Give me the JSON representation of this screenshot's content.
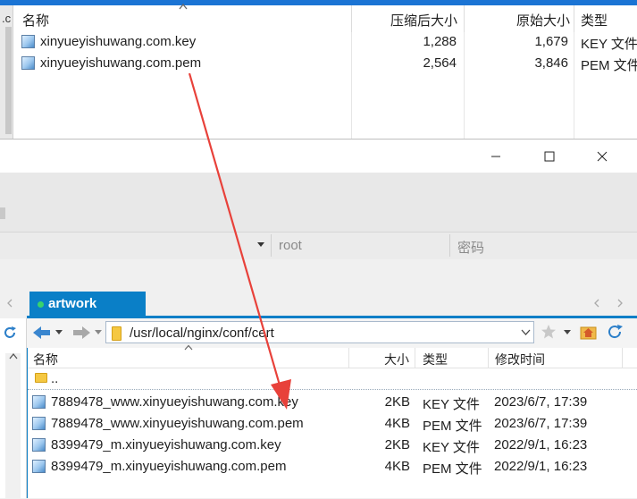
{
  "archive": {
    "left_edge_label": ".c",
    "columns": {
      "name": "名称",
      "compressed": "压缩后大小",
      "original": "原始大小",
      "type": "类型"
    },
    "files": [
      {
        "name": "xinyueyishuwang.com.key",
        "compressed": "1,288",
        "original": "1,679",
        "type": "KEY 文件"
      },
      {
        "name": "xinyueyishuwang.com.pem",
        "compressed": "2,564",
        "original": "3,846",
        "type": "PEM 文件"
      }
    ]
  },
  "window": {
    "connection": {
      "user_placeholder": "root",
      "password_placeholder": "密码"
    },
    "tab": {
      "label": "artwork",
      "status_color": "#39d36c"
    },
    "path": "/usr/local/nginx/conf/cert",
    "columns": {
      "name": "名称",
      "size": "大小",
      "type": "类型",
      "modified": "修改时间"
    },
    "parent_dir": "..",
    "files": [
      {
        "name": "7889478_www.xinyueyishuwang.com.key",
        "size": "2KB",
        "type": "KEY 文件",
        "modified": "2023/6/7, 17:39"
      },
      {
        "name": "7889478_www.xinyueyishuwang.com.pem",
        "size": "4KB",
        "type": "PEM 文件",
        "modified": "2023/6/7, 17:39"
      },
      {
        "name": "8399479_m.xinyueyishuwang.com.key",
        "size": "2KB",
        "type": "KEY 文件",
        "modified": "2022/9/1, 16:23"
      },
      {
        "name": "8399479_m.xinyueyishuwang.com.pem",
        "size": "4KB",
        "type": "PEM 文件",
        "modified": "2022/9/1, 16:23"
      }
    ]
  },
  "annotation": {
    "arrow_color": "#e8413a"
  },
  "colors": {
    "accent": "#0a7fc7",
    "top_strip": "#1b74d4"
  }
}
